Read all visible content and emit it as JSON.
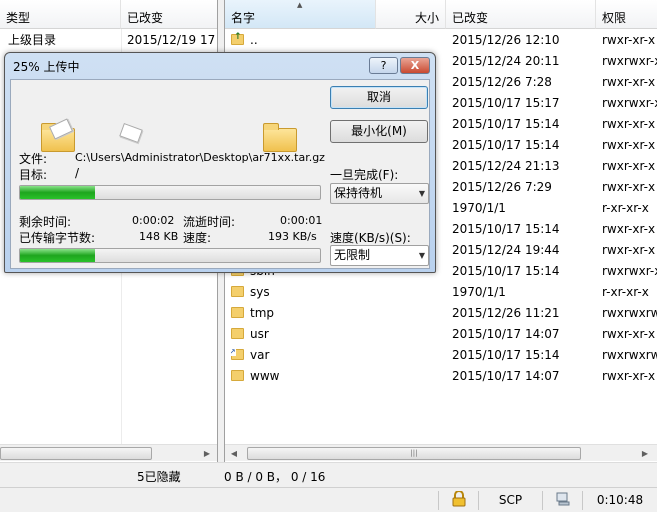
{
  "left_panel": {
    "columns": [
      "类型",
      "已改变"
    ],
    "rows": [
      {
        "type": "上级目录",
        "changed": "2015/12/19  17"
      }
    ],
    "hidden_info": "5已隐藏"
  },
  "right_panel": {
    "columns": [
      "名字",
      "大小",
      "已改变",
      "权限"
    ],
    "rows": [
      {
        "name": "..",
        "changed": "2015/12/26 12:10",
        "perm": "rwxr-xr-x",
        "icon": "up-folder-icon"
      },
      {
        "name": "",
        "changed": "2015/12/24 20:11",
        "perm": "rwxrwxr-x",
        "icon": "folder-icon"
      },
      {
        "name": "",
        "changed": "2015/12/26 7:28",
        "perm": "rwxr-xr-x",
        "icon": "folder-icon"
      },
      {
        "name": "",
        "changed": "2015/10/17 15:17",
        "perm": "rwxrwxr-x",
        "icon": "folder-icon"
      },
      {
        "name": "",
        "changed": "2015/10/17 15:14",
        "perm": "rwxr-xr-x",
        "icon": "folder-icon"
      },
      {
        "name": "",
        "changed": "2015/10/17 15:14",
        "perm": "rwxr-xr-x",
        "icon": "folder-icon"
      },
      {
        "name": "",
        "changed": "2015/12/24 21:13",
        "perm": "rwxr-xr-x",
        "icon": "folder-icon"
      },
      {
        "name": "",
        "changed": "2015/12/26 7:29",
        "perm": "rwxr-xr-x",
        "icon": "folder-icon"
      },
      {
        "name": "",
        "changed": "1970/1/1",
        "perm": "r-xr-xr-x",
        "icon": "folder-icon"
      },
      {
        "name": "",
        "changed": "2015/10/17 15:14",
        "perm": "rwxr-xr-x",
        "icon": "folder-icon"
      },
      {
        "name": "",
        "changed": "2015/12/24 19:44",
        "perm": "rwxr-xr-x",
        "icon": "folder-icon"
      },
      {
        "name": "sbin",
        "changed": "2015/10/17 15:14",
        "perm": "rwxrwxr-x",
        "icon": "folder-icon"
      },
      {
        "name": "sys",
        "changed": "1970/1/1",
        "perm": "r-xr-xr-x",
        "icon": "folder-icon"
      },
      {
        "name": "tmp",
        "changed": "2015/12/26 11:21",
        "perm": "rwxrwxrwt",
        "icon": "folder-icon"
      },
      {
        "name": "usr",
        "changed": "2015/10/17 14:07",
        "perm": "rwxr-xr-x",
        "icon": "folder-icon"
      },
      {
        "name": "var",
        "changed": "2015/10/17 15:14",
        "perm": "rwxrwxrwx",
        "icon": "folder-link-icon"
      },
      {
        "name": "www",
        "changed": "2015/10/17 14:07",
        "perm": "rwxr-xr-x",
        "icon": "folder-icon"
      }
    ],
    "transfer_info": "0 B / 0 B， 0 / 16"
  },
  "status_bar": {
    "protocol": "SCP",
    "time": "0:10:48",
    "icons": [
      "lock-icon",
      "server-icon"
    ]
  },
  "dialog": {
    "title": "25% 上传中",
    "help_label": "?",
    "close_label": "X",
    "cancel_label": "取消",
    "minimize_label": "最小化(M)",
    "file_label": "文件:",
    "file_value": "C:\\Users\\Administrator\\Desktop\\ar71xx.tar.gz",
    "target_label": "目标:",
    "target_value": "/",
    "file_progress": 0.25,
    "remaining_label": "剩余时间:",
    "remaining_value": "0:00:02",
    "elapsed_label": "流逝时间:",
    "elapsed_value": "0:00:01",
    "transferred_label": "已传输字节数:",
    "transferred_value": "148 KB",
    "speed_label": "速度:",
    "speed_value": "193 KB/s",
    "total_progress": 0.25,
    "once_done_label": "一旦完成(F):",
    "once_done_value": "保持待机",
    "speed_limit_label": "速度(KB/s)(S):",
    "speed_limit_value": "无限制"
  }
}
